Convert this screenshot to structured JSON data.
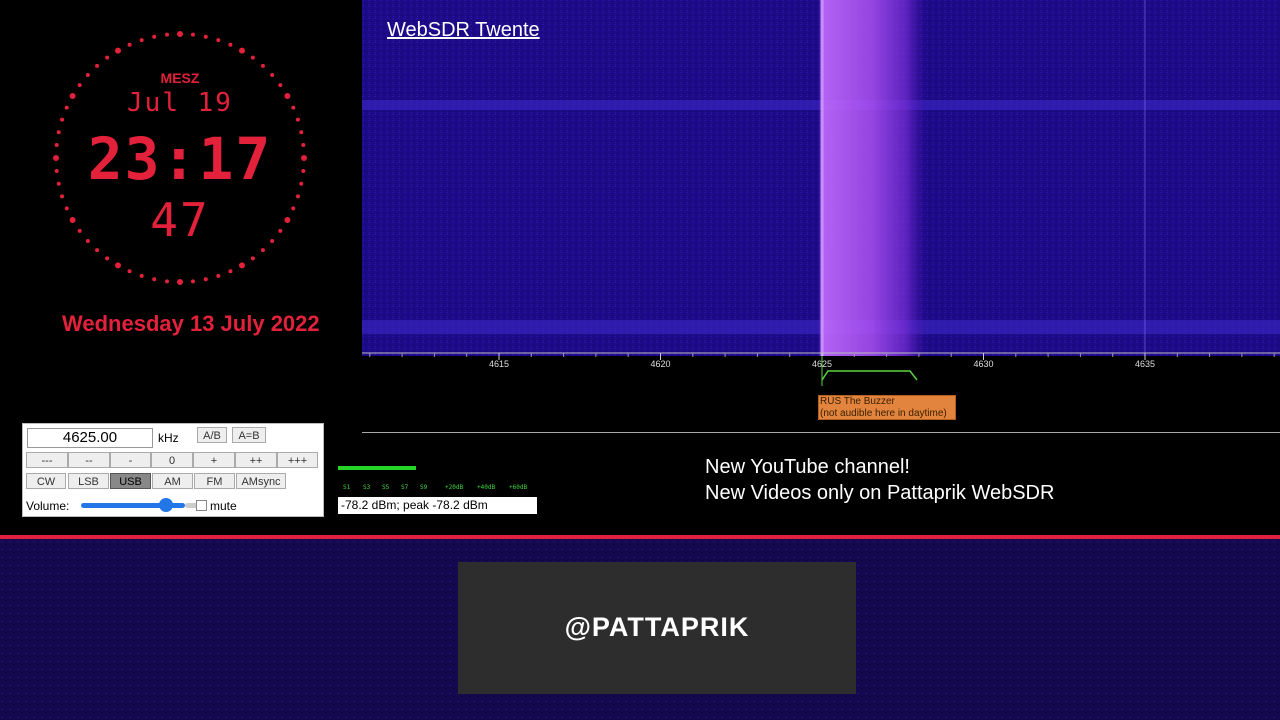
{
  "clock": {
    "timezone": "MESZ",
    "date_short": "Jul 19",
    "time": "23:17",
    "seconds": "47",
    "date_full": "Wednesday 13 July 2022",
    "color": "#e3213b"
  },
  "waterfall": {
    "title": "WebSDR Twente",
    "colors": {
      "background": "#1f0a8a",
      "signal": "#c46cff"
    }
  },
  "scale": {
    "ticks": [
      "4615",
      "4620",
      "4625",
      "4630",
      "4635"
    ]
  },
  "station": {
    "line1": "RUS The Buzzer",
    "line2": "(not audible here in daytime)",
    "color": "#e2843d"
  },
  "control": {
    "frequency": "4625.00",
    "unit": "kHz",
    "ab_buttons": [
      "A/B",
      "A=B"
    ],
    "step_buttons": [
      "---",
      "--",
      "-",
      "0",
      "+",
      "++",
      "+++"
    ],
    "mode_buttons": [
      "CW",
      "LSB",
      "USB",
      "AM",
      "FM",
      "AMsync"
    ],
    "selected_mode": "USB",
    "volume_label": "Volume:",
    "volume_level": 0.8,
    "mute_label": "mute",
    "mute_checked": false
  },
  "smeter": {
    "scale_labels": [
      "S1",
      "S3",
      "S5",
      "S7",
      "S9",
      "+20dB",
      "+40dB",
      "+60dB"
    ],
    "reading": "-78.2 dBm; peak  -78.2 dBm",
    "color": "#25d427"
  },
  "announcement": {
    "line1": "New YouTube channel!",
    "line2": "New Videos only on Pattaprik WebSDR"
  },
  "banner": {
    "handle": "@PATTAPRIK"
  }
}
